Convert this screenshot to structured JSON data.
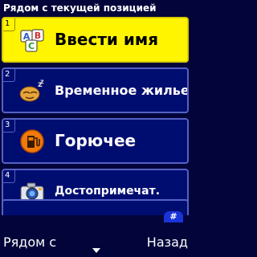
{
  "title": "Рядом с текущей позицией",
  "items": [
    {
      "number": "1",
      "label": "Ввести имя",
      "icon": "abc-blocks-icon",
      "selected": true
    },
    {
      "number": "2",
      "label": "Временное жилье",
      "icon": "sleeping-zz-icon",
      "selected": false
    },
    {
      "number": "3",
      "label": "Горючее",
      "icon": "fuel-pump-icon",
      "selected": false
    },
    {
      "number": "4",
      "label": "Достопримечат.",
      "icon": "camera-icon",
      "selected": false
    }
  ],
  "scroll_hint": "#",
  "softkeys": {
    "left": "Рядом с",
    "right": "Назад",
    "center": "chevron-down-icon"
  },
  "colors": {
    "background": "#02043a",
    "item_bg": "#000d70",
    "selected_bg": "#fff500",
    "border": "#5561c4"
  }
}
